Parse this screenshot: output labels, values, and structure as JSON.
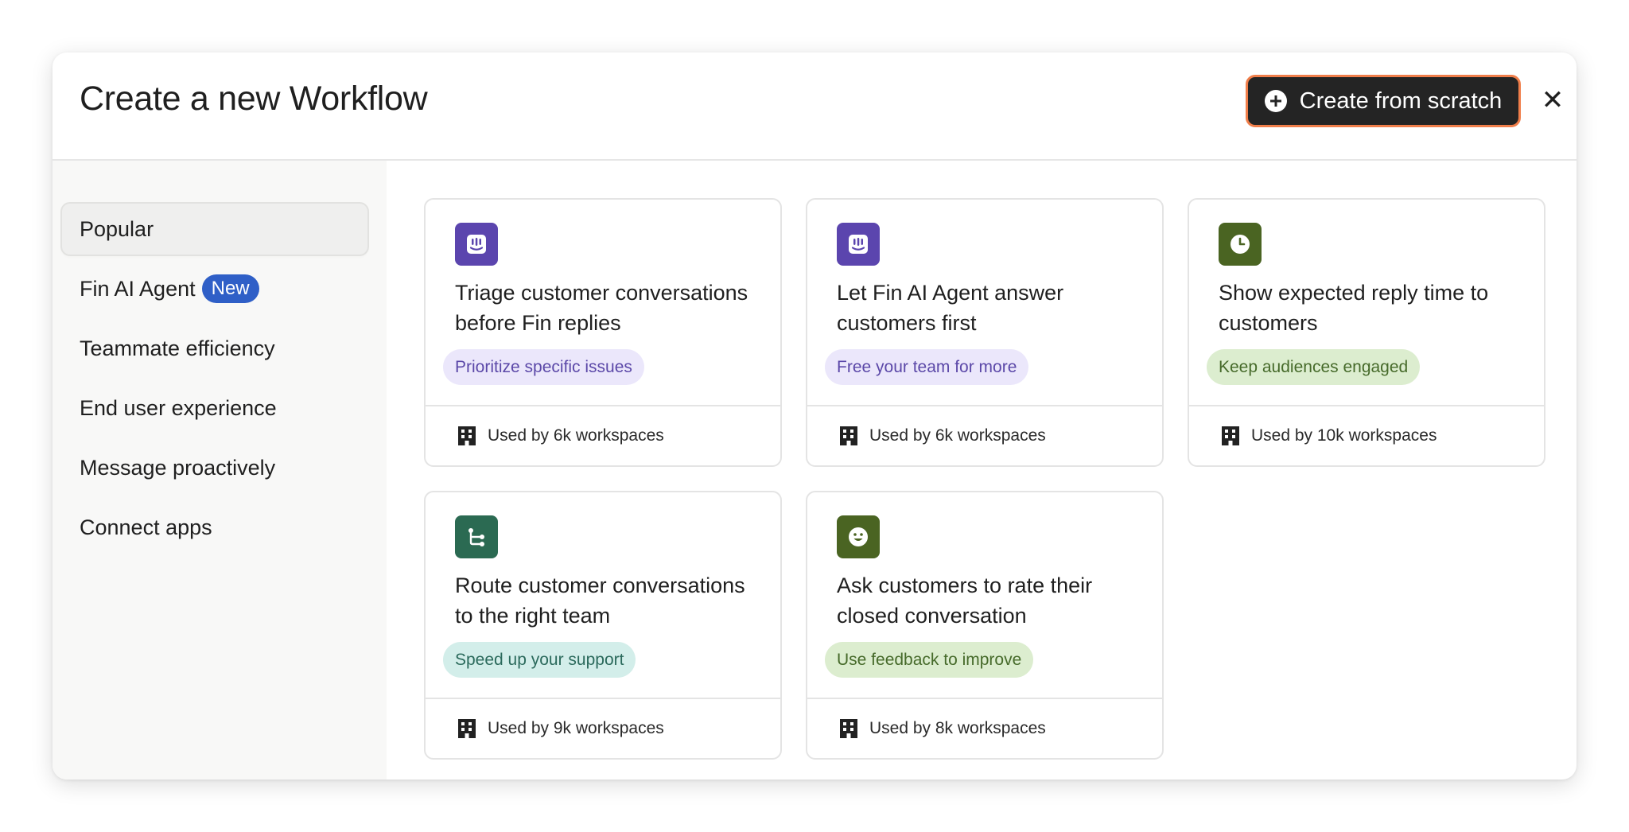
{
  "modal": {
    "title": "Create a new Workflow",
    "create_button_label": "Create from scratch",
    "close_label": "✕"
  },
  "sidebar": {
    "items": [
      {
        "label": "Popular",
        "active": true
      },
      {
        "label": "Fin AI Agent",
        "badge": "New"
      },
      {
        "label": "Teammate efficiency"
      },
      {
        "label": "End user experience"
      },
      {
        "label": "Message proactively"
      },
      {
        "label": "Connect apps"
      }
    ]
  },
  "cards": [
    {
      "title": "Triage customer conversations before Fin replies",
      "tag": "Prioritize specific issues",
      "usage": "Used by 6k workspaces",
      "icon": "fin-icon",
      "icon_color": "#5b45ae",
      "tag_bg": "#ebe7fb",
      "tag_color": "#5b48a8"
    },
    {
      "title": "Let Fin AI Agent answer customers first",
      "tag": "Free your team for more",
      "usage": "Used by 6k workspaces",
      "icon": "fin-icon",
      "icon_color": "#5b45ae",
      "tag_bg": "#ebe7fb",
      "tag_color": "#5b48a8"
    },
    {
      "title": "Show expected reply time to customers",
      "tag": "Keep audiences engaged",
      "usage": "Used by 10k workspaces",
      "icon": "clock-icon",
      "icon_color": "#4a6422",
      "tag_bg": "#dcedcf",
      "tag_color": "#466a2a"
    },
    {
      "title": "Route customer conversations to the right team",
      "tag": "Speed up your support",
      "usage": "Used by 9k workspaces",
      "icon": "route-icon",
      "icon_color": "#2b6a52",
      "tag_bg": "#d3eeea",
      "tag_color": "#2b6a5c"
    },
    {
      "title": "Ask customers to rate their closed conversation",
      "tag": "Use feedback to improve",
      "usage": "Used by 8k workspaces",
      "icon": "smiley-icon",
      "icon_color": "#4a6422",
      "tag_bg": "#dcedcf",
      "tag_color": "#466a2a"
    }
  ]
}
